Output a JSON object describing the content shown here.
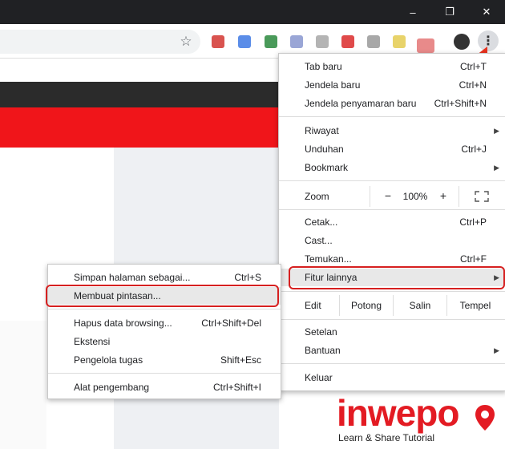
{
  "window": {
    "controls": {
      "minimize": "–",
      "maximize": "❐",
      "close": "✕"
    }
  },
  "toolbar": {
    "star_icon": "☆",
    "menu_icon": "⋮"
  },
  "main_menu": {
    "items": [
      {
        "label": "Tab baru",
        "shortcut": "Ctrl+T"
      },
      {
        "label": "Jendela baru",
        "shortcut": "Ctrl+N"
      },
      {
        "label": "Jendela penyamaran baru",
        "shortcut": "Ctrl+Shift+N"
      },
      {
        "label": "Riwayat",
        "shortcut": ""
      },
      {
        "label": "Unduhan",
        "shortcut": "Ctrl+J"
      },
      {
        "label": "Bookmark",
        "shortcut": ""
      },
      {
        "label": "Cetak...",
        "shortcut": "Ctrl+P"
      },
      {
        "label": "Cast...",
        "shortcut": ""
      },
      {
        "label": "Temukan...",
        "shortcut": "Ctrl+F"
      },
      {
        "label": "Fitur lainnya",
        "shortcut": ""
      },
      {
        "label": "Setelan",
        "shortcut": ""
      },
      {
        "label": "Bantuan",
        "shortcut": ""
      },
      {
        "label": "Keluar",
        "shortcut": ""
      }
    ],
    "zoom": {
      "label": "Zoom",
      "minus": "−",
      "value": "100%",
      "plus": "+"
    },
    "edit": {
      "label": "Edit",
      "cut": "Potong",
      "copy": "Salin",
      "paste": "Tempel"
    }
  },
  "submenu": {
    "items": [
      {
        "label": "Simpan halaman sebagai...",
        "shortcut": "Ctrl+S"
      },
      {
        "label": "Membuat pintasan...",
        "shortcut": ""
      },
      {
        "label": "Hapus data browsing...",
        "shortcut": "Ctrl+Shift+Del"
      },
      {
        "label": "Ekstensi",
        "shortcut": ""
      },
      {
        "label": "Pengelola tugas",
        "shortcut": "Shift+Esc"
      },
      {
        "label": "Alat pengembang",
        "shortcut": "Ctrl+Shift+I"
      }
    ]
  },
  "logo": {
    "brand": "inwepo",
    "tagline": "Learn & Share Tutorial"
  },
  "colors": {
    "highlight": "#d62020",
    "brand": "#e31b23",
    "dark": "#202124"
  }
}
